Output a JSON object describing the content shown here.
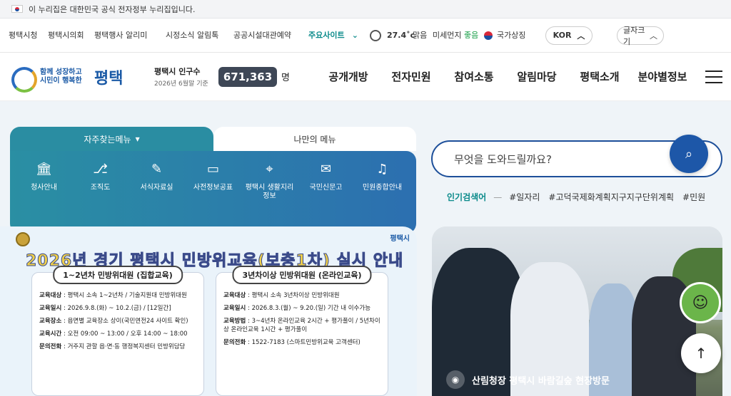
{
  "gov": {
    "notice": "이 누리집은 대한민국 공식 전자정부 누리집입니다."
  },
  "util": {
    "links": [
      "평택시청",
      "평택시의회",
      "평택행사 알리미",
      "시정소식 알림톡",
      "공공시설대관예약"
    ],
    "main_sites": "주요사이트",
    "weather": {
      "temp": "27.4˚c",
      "sky": "맑음"
    },
    "dust_label": "미세먼지",
    "dust_value": "좋음",
    "national": "국가상징",
    "lang": "KOR",
    "font": "글자크기"
  },
  "header": {
    "slogan_1": "함께 성장하고",
    "slogan_2": "시민이 행복한",
    "logo_name": "평택",
    "pop_title": "평택시 인구수",
    "pop_date": "2026년 6월말 기준",
    "pop_value": "671,363",
    "pop_unit": "명",
    "gnb": [
      "공개개방",
      "전자민원",
      "참여소통",
      "알림마당",
      "평택소개",
      "분야별정보"
    ]
  },
  "quick": {
    "tab_active": "자주찾는메뉴",
    "tab_other": "나만의 메뉴",
    "items": [
      {
        "icon": "building-icon",
        "label": "청사안내"
      },
      {
        "icon": "org-chart-icon",
        "label": "조직도"
      },
      {
        "icon": "document-icon",
        "label": "서식자료실"
      },
      {
        "icon": "folder-icon",
        "label": "사전정보공표"
      },
      {
        "icon": "map-pin-icon",
        "label": "평택시 생활지리정보"
      },
      {
        "icon": "message-icon",
        "label": "국민신문고"
      },
      {
        "icon": "bell-icon",
        "label": "민원종합안내"
      }
    ]
  },
  "search": {
    "placeholder": "무엇을 도와드릴까요?",
    "popular_label": "인기검색어",
    "keywords": [
      "#일자리",
      "#고덕국제화계획지구지구단위계획",
      "#민원"
    ]
  },
  "banner": {
    "title": "2026년 경기 평택시 민방위교육(보충1차) 실시 안내",
    "org": "평택시",
    "left": {
      "heading": "1~2년차 민방위대원 (집합교육)",
      "rows": [
        {
          "k": "교육대상",
          "v": "평택시 소속 1~2년차 / 기술지원대 민방위대원"
        },
        {
          "k": "교육일시",
          "v": "2026.9.8.(화) ~ 10.2.(금) / [12일간]"
        },
        {
          "k": "교육장소",
          "v": "읍면별 교육장소 상이(국민연전24 사이트 확인)"
        },
        {
          "k": "교육시간",
          "v": "오전 09:00 ~ 13:00 / 오후 14:00 ~ 18:00"
        },
        {
          "k": "문의전화",
          "v": "거주지 관할 읍·면·동 행정복지센터 민방위담당"
        }
      ]
    },
    "right": {
      "heading": "3년차이상 민방위대원 (온라인교육)",
      "rows": [
        {
          "k": "교육대상",
          "v": "평택시 소속 3년차이상 민방위대원"
        },
        {
          "k": "교육일시",
          "v": "2026.8.3.(월) ~ 9.20.(일) 기간 내 이수가능"
        },
        {
          "k": "교육방법",
          "v": "3~4년차 온라인교육 2시간 + 평가풀이 / 5년차이상 온라인교육 1시간 + 평가풀이"
        },
        {
          "k": "문의전화",
          "v": "1522-7183 (스마트민방위교육 고객센터)"
        }
      ]
    }
  },
  "photo": {
    "caption": "산림청장 평택시 바람길숲 현장방문"
  }
}
